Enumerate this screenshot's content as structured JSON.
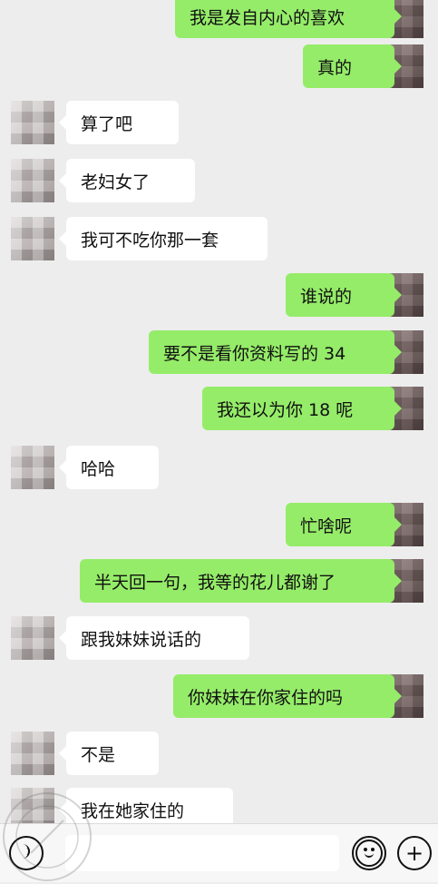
{
  "messages": [
    {
      "side": "right",
      "text": "我是发自内心的喜欢"
    },
    {
      "side": "right",
      "text": "真的"
    },
    {
      "side": "left",
      "text": "算了吧"
    },
    {
      "side": "left",
      "text": "老妇女了"
    },
    {
      "side": "left",
      "text": "我可不吃你那一套"
    },
    {
      "side": "right",
      "text": "谁说的"
    },
    {
      "side": "right",
      "text": "要不是看你资料写的 34"
    },
    {
      "side": "right",
      "text": "我还以为你 18 呢"
    },
    {
      "side": "left",
      "text": "哈哈"
    },
    {
      "side": "right",
      "text": "忙啥呢"
    },
    {
      "side": "right",
      "text": "半天回一句，我等的花儿都谢了"
    },
    {
      "side": "left",
      "text": "跟我妹妹说话的"
    },
    {
      "side": "right",
      "text": "你妹妹在你家住的吗"
    },
    {
      "side": "left",
      "text": "不是"
    },
    {
      "side": "left",
      "text": "我在她家住的"
    }
  ],
  "footer": {
    "voice_icon": "voice-icon",
    "emoji_icon": "emoji-icon",
    "add_icon": "plus-icon",
    "add_symbol": "+"
  },
  "colors": {
    "background": "#ededed",
    "self_bubble": "#95ec69",
    "other_bubble": "#ffffff"
  }
}
